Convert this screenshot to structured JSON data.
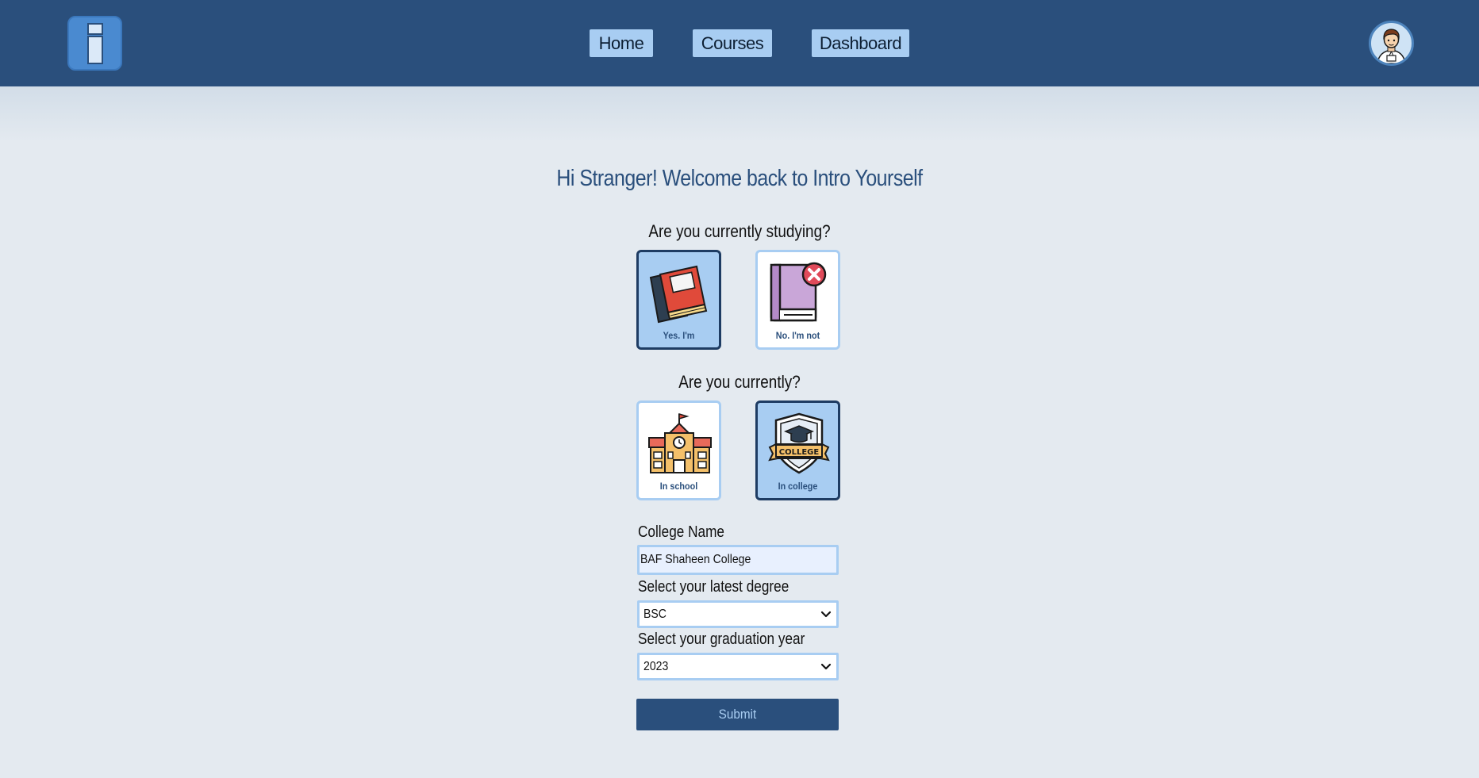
{
  "header": {
    "logo_letter": "i",
    "nav": {
      "home": "Home",
      "courses": "Courses",
      "dashboard": "Dashboard"
    },
    "avatar_icon": "user-avatar-icon"
  },
  "main": {
    "title": "Hi Stranger! Welcome back to Intro Yourself",
    "studying_question": "Are you currently studying?",
    "studying_options": {
      "yes": {
        "label": "Yes. I'm",
        "icon": "books-icon",
        "selected": true
      },
      "no": {
        "label": "No. I'm not",
        "icon": "book-closed-icon",
        "selected": false
      }
    },
    "current_question": "Are you currently?",
    "current_options": {
      "school": {
        "label": "In school",
        "icon": "school-building-icon",
        "selected": false
      },
      "college": {
        "label": "In college",
        "icon": "college-badge-icon",
        "selected": true
      }
    },
    "form": {
      "college_name_label": "College Name",
      "college_name_value": "BAF Shaheen College",
      "degree_label": "Select your latest degree",
      "degree_value": "BSC",
      "year_label": "Select your graduation year",
      "year_value": "2023",
      "submit_label": "Submit"
    }
  },
  "colors": {
    "header_bg": "#2a4f7c",
    "accent": "#a8cdf2",
    "page_bg": "#e4eaf0"
  }
}
